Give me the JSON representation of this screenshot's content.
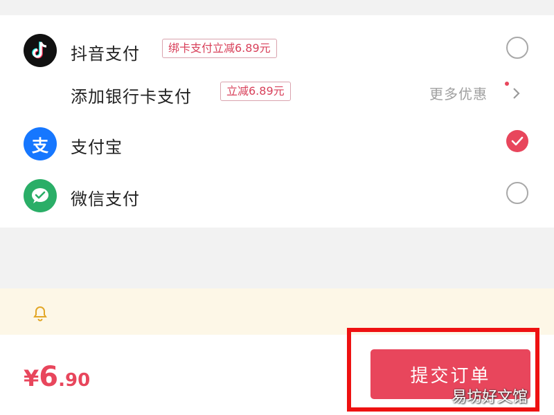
{
  "payment_methods": {
    "douyin": {
      "label": "抖音支付",
      "tag": "绑卡支付立减6.89元"
    },
    "bank_card": {
      "label": "添加银行卡支付",
      "tag": "立减6.89元",
      "more_label": "更多优惠"
    },
    "alipay": {
      "label": "支付宝",
      "logo_glyph": "支"
    },
    "wechat": {
      "label": "微信支付"
    }
  },
  "selected_method": "alipay",
  "icons": [
    "douyin-logo-icon",
    "alipay-logo-icon",
    "wechat-logo-icon",
    "check-icon",
    "chevron-right-icon",
    "bell-icon"
  ],
  "footer": {
    "currency_symbol": "¥",
    "price_integer": "6",
    "price_decimal": ".90",
    "submit_label": "提交订单"
  },
  "watermark": "易坊好文馆",
  "colors": {
    "accent": "#e8465c",
    "alipay_blue": "#1677ff",
    "wechat_green": "#2aae67",
    "notice_bg": "#fdf7e7",
    "highlight_red": "#ee1111"
  }
}
